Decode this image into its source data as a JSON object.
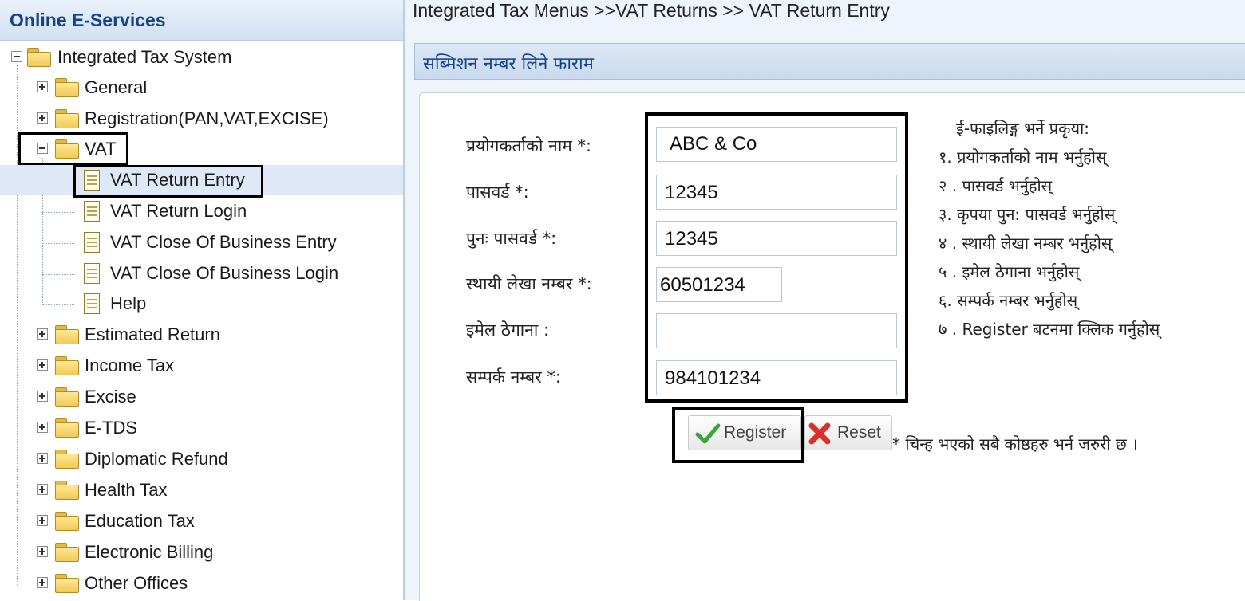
{
  "sidebar": {
    "title": "Online E-Services",
    "root": "Integrated Tax System",
    "items": [
      "General",
      "Registration(PAN,VAT,EXCISE)",
      "VAT",
      "VAT Return Entry",
      "VAT Return Login",
      "VAT Close Of Business Entry",
      "VAT Close Of Business Login",
      "Help",
      "Estimated Return",
      "Income Tax",
      "Excise",
      "E-TDS",
      "Diplomatic Refund",
      "Health Tax",
      "Education Tax",
      "Electronic Billing",
      "Other Offices"
    ],
    "selected": "VAT Return Entry"
  },
  "breadcrumb": "Integrated Tax Menus >>VAT Returns >> VAT Return Entry",
  "form": {
    "title": "सब्मिशन नम्बर लिने फाराम",
    "fields": [
      {
        "label": "प्रयोगकर्ताको नाम *:",
        "value": "ABC & Co"
      },
      {
        "label": "पासवर्ड *:",
        "value": "12345"
      },
      {
        "label": "पुनः पासवर्ड *:",
        "value": "12345"
      },
      {
        "label": "स्थायी लेखा नम्बर *:",
        "value": "60501234"
      },
      {
        "label": "इमेल ठेगाना :",
        "value": ""
      },
      {
        "label": "सम्पर्क नम्बर *:",
        "value": "984101234"
      }
    ],
    "register_label": "Register",
    "reset_label": "Reset",
    "required_note": "* चिन्ह भएको सबै कोष्ठहरु भर्न जरुरी छ ।"
  },
  "instructions": {
    "title": "ई-फाइलिङ्ग भर्ने प्रकृया:",
    "steps": [
      "१. प्रयोगकर्ताको नाम भर्नुहोस्",
      "२ . पासवर्ड भर्नुहोस्",
      "३. कृपया पुन: पासवर्ड भर्नुहोस्",
      "४ . स्थायी लेखा नम्बर भर्नुहोस्",
      "५ . इमेल ठेगाना भर्नुहोस्",
      "६. सम्पर्क नम्बर भर्नुहोस्",
      "७ . Register बटनमा क्लिक गर्नुहोस्"
    ]
  },
  "colors": {
    "header_text": "#15428b",
    "selected_row": "#dfe8f6",
    "panel_bg": "#eef4fc",
    "register_check": "#3aa63a",
    "reset_x": "#d8322b",
    "highlight_box": "#000000"
  }
}
